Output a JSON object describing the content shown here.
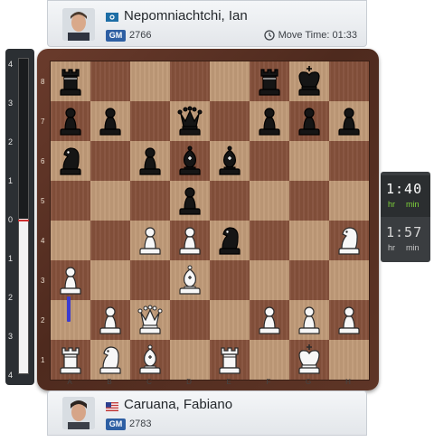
{
  "top_player": {
    "name": "Nepomniachtchi, Ian",
    "title": "GM",
    "rating": "2766",
    "move_time_label": "Move Time: 01:33",
    "flag_icon": "flag-icon"
  },
  "bottom_player": {
    "name": "Caruana, Fabiano",
    "title": "GM",
    "rating": "2783",
    "flag_icon": "us-flag-icon"
  },
  "clocks": {
    "active": {
      "time": "1:40",
      "unit_hr": "hr",
      "unit_min": "min"
    },
    "idle": {
      "time": "1:57",
      "unit_hr": "hr",
      "unit_min": "min"
    }
  },
  "eval_bar": {
    "ticks": [
      "4",
      "3",
      "2",
      "1",
      "0",
      "1",
      "2",
      "3",
      "4"
    ],
    "white_advantage_fraction": 0.49
  },
  "board": {
    "files": [
      "A",
      "B",
      "C",
      "D",
      "E",
      "F",
      "G",
      "H"
    ],
    "ranks": [
      "8",
      "7",
      "6",
      "5",
      "4",
      "3",
      "2",
      "1"
    ],
    "position": [
      [
        "bR",
        "",
        "",
        "",
        "",
        "bR",
        "bK",
        ""
      ],
      [
        "bP",
        "bP",
        "",
        "bQ",
        "",
        "bP",
        "bP",
        "bP"
      ],
      [
        "bN",
        "",
        "bP",
        "bB",
        "bB",
        "",
        "",
        ""
      ],
      [
        "",
        "",
        "",
        "bP",
        "",
        "",
        "",
        ""
      ],
      [
        "",
        "",
        "wP",
        "wP",
        "bN",
        "",
        "",
        "wN"
      ],
      [
        "wP",
        "",
        "",
        "wB",
        "",
        "",
        "",
        ""
      ],
      [
        "",
        "wP",
        "wQ",
        "",
        "",
        "wP",
        "wP",
        "wP"
      ],
      [
        "wR",
        "wN",
        "wB",
        "",
        "wR",
        "",
        "wK",
        ""
      ]
    ],
    "last_move": {
      "from": "a2",
      "to": "a3"
    }
  },
  "colors": {
    "light_square": "#bf9a78",
    "dark_square": "#84503b",
    "frame": "#5a2f22",
    "move_arrow": "#3b3bd1",
    "clock_units_active": "#7fd33a"
  }
}
